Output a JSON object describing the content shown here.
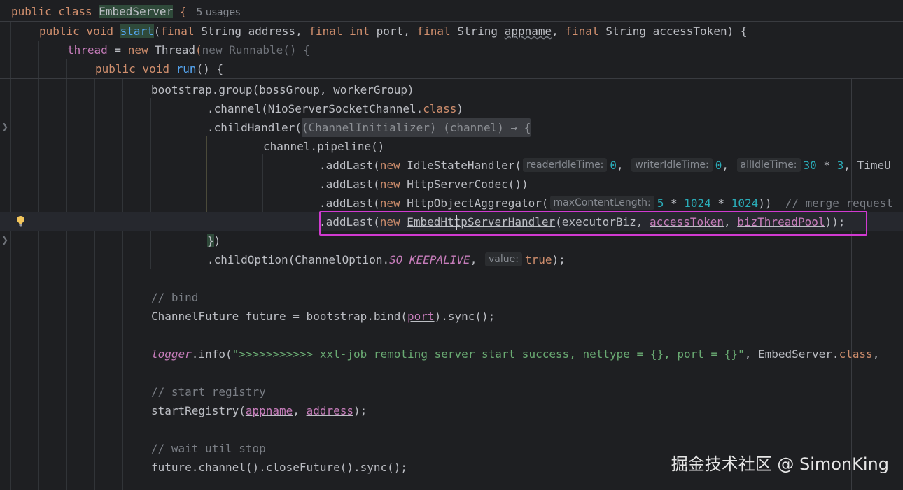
{
  "editor": {
    "usages_hint": "5 usages",
    "watermark": "掘金技术社区 @ SimonKing"
  },
  "code": {
    "l1": {
      "a": "public class ",
      "b": "EmbedServer",
      "c": " {"
    },
    "l2": {
      "a": "public void ",
      "b": "start",
      "c": "(",
      "d": "final ",
      "e": "String address, ",
      "f": "final int ",
      "g": "port, ",
      "h": "final ",
      "i": "String ",
      "j": "appname",
      "k": ", ",
      "l": "final ",
      "m": "String accessToken) {"
    },
    "l3": {
      "a": "thread",
      "b": " = ",
      "c": "new ",
      "d": "Thread",
      "e": "(",
      "f": "new Runnable() {"
    },
    "l4": {
      "a": "public void ",
      "b": "run",
      "c": "() {"
    },
    "l5": {
      "a": "bootstrap.group(bossGroup, workerGroup)"
    },
    "l6": {
      "a": ".channel(NioServerSocketChannel.",
      "b": "class",
      "c": ")"
    },
    "l7": {
      "a": ".childHandler(",
      "b": "(ChannelInitializer) (channel) → {"
    },
    "l8": {
      "a": "channel.pipeline()"
    },
    "l9": {
      "a": ".addLast(",
      "b": "new ",
      "c": "IdleStateHandler(",
      "h1": "readerIdleTime:",
      "n1": "0",
      "c2": ", ",
      "h2": "writerIdleTime:",
      "n2": "0",
      "c3": ", ",
      "h3": "allIdleTime:",
      "n3": "30",
      "d": " * ",
      "n4": "3",
      "e": ", TimeU"
    },
    "l10": {
      "a": ".addLast(",
      "b": "new ",
      "c": "HttpServerCodec())"
    },
    "l11": {
      "a": ".addLast(",
      "b": "new ",
      "c": "HttpObjectAggregator(",
      "h1": "maxContentLength:",
      "n1": "5",
      "d": " * ",
      "n2": "1024",
      "e": " * ",
      "n3": "1024",
      "f": "))",
      "g": "  // merge request"
    },
    "l12": {
      "a": ".addLast(",
      "b": "new ",
      "c1": "EmbedHt",
      "c2": "tpServerHandler",
      "d": "(executorBiz, ",
      "e": "accessToken",
      "f": ", ",
      "g": "bizThreadPool",
      "h": "));"
    },
    "l13": {
      "a": "}",
      "b": ")"
    },
    "l14": {
      "a": ".childOption(ChannelOption.",
      "b": "SO_KEEPALIVE",
      "c": ", ",
      "h1": "value:",
      "d": "true",
      "e": ");"
    },
    "l16": {
      "a": "// bind"
    },
    "l17": {
      "a": "ChannelFuture future = bootstrap.bind(",
      "b": "port",
      "c": ").sync();"
    },
    "l19": {
      "a": "logger",
      "b": ".info(",
      "c": "\">>>>>>>>>>> xxl-job remoting server start success, ",
      "d": "nettype",
      "e": " = {}, port = {}\"",
      "f": ", EmbedServer.",
      "g": "class",
      "h": ","
    },
    "l21": {
      "a": "// start registry"
    },
    "l22": {
      "a": "startRegistry(",
      "b": "appname",
      "c": ", ",
      "d": "address",
      "e": ");"
    },
    "l24": {
      "a": "// wait util stop"
    },
    "l25": {
      "a": "future.channel().closeFuture().sync();"
    }
  }
}
